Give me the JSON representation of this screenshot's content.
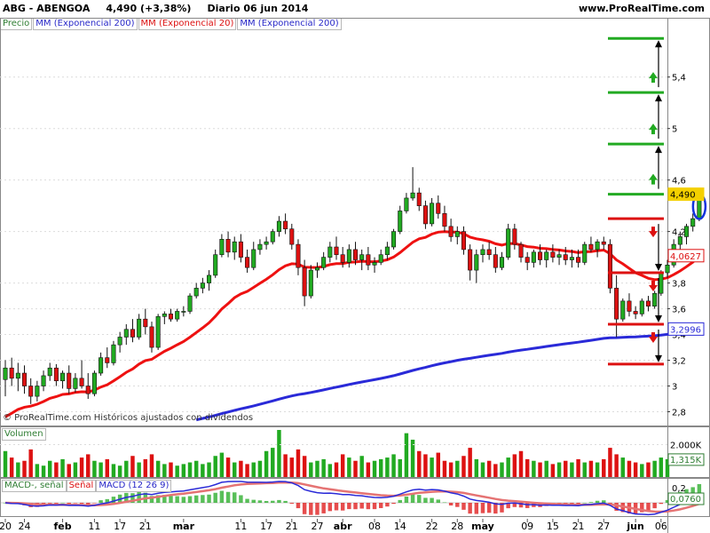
{
  "header": {
    "ticker": "ABG - ABENGOA",
    "price_change": "4,490 (+3,38%)",
    "period_date": "Diario  06 jun 2014",
    "site": "www.ProRealTime.com"
  },
  "indicators": {
    "precio": "Precio",
    "ema200_a": "MM (Exponencial 200)",
    "ema20": "MM (Exponencial 20)",
    "ema200_b": "MM (Exponencial 200)"
  },
  "volume_panel": {
    "label": "Volumen"
  },
  "macd_panel": {
    "label_macd_signal": "MACD-, señal",
    "label_senal": "Señal",
    "label_macd": "MACD (12 26 9)"
  },
  "footnote": "© ProRealTime.com  Históricos ajustados con dividendos",
  "colors": {
    "up": "#21aa21",
    "down": "#dd1111",
    "ema20": "#ee1111",
    "ema200": "#2a2ad8",
    "grid": "#dcdcdc",
    "marker": "#1133dd"
  },
  "chart_data": [
    {
      "type": "candlestick",
      "title": "ABG - ABENGOA",
      "ylim": [
        2.7,
        5.75
      ],
      "y_ticks": [
        "5,4",
        "5",
        "4,6",
        "4,2",
        "3,8",
        "3,4",
        "3",
        "2,8",
        "3,6",
        "3,2"
      ],
      "y_tick_values": [
        5.4,
        5.0,
        4.6,
        4.2,
        3.8,
        3.4,
        3.0,
        2.8,
        3.6,
        3.2
      ],
      "x_labels": [
        "20",
        "24",
        "feb",
        "11",
        "17",
        "21",
        "mar",
        "11",
        "17",
        "21",
        "27",
        "abr",
        "08",
        "14",
        "22",
        "28",
        "may",
        "09",
        "15",
        "21",
        "27",
        "jun",
        "06"
      ],
      "x_label_days": [
        0,
        3,
        9,
        14,
        18,
        22,
        28,
        37,
        41,
        45,
        49,
        53,
        58,
        62,
        67,
        71,
        75,
        82,
        86,
        90,
        94,
        99,
        103
      ],
      "num_days": 104,
      "price_labels": {
        "last": "4,490",
        "ema20": "4,0627",
        "ema200": "3,2996"
      },
      "target_levels": [
        5.7,
        5.28,
        4.88,
        4.49
      ],
      "stop_levels": [
        4.3,
        3.88,
        3.48,
        3.17
      ],
      "candles": [
        [
          3.05,
          3.2,
          2.92,
          3.14
        ],
        [
          3.14,
          3.22,
          3.0,
          3.06
        ],
        [
          3.06,
          3.18,
          2.96,
          3.1
        ],
        [
          3.1,
          3.16,
          2.94,
          3.0
        ],
        [
          3.0,
          3.06,
          2.86,
          2.92
        ],
        [
          2.92,
          3.04,
          2.88,
          3.0
        ],
        [
          3.0,
          3.12,
          2.96,
          3.08
        ],
        [
          3.08,
          3.18,
          3.04,
          3.14
        ],
        [
          3.14,
          3.17,
          3.0,
          3.04
        ],
        [
          3.04,
          3.12,
          2.98,
          3.1
        ],
        [
          3.1,
          3.16,
          2.94,
          2.98
        ],
        [
          2.98,
          3.1,
          2.95,
          3.06
        ],
        [
          3.06,
          3.2,
          2.98,
          3.0
        ],
        [
          3.0,
          3.1,
          2.9,
          2.94
        ],
        [
          2.94,
          3.12,
          2.92,
          3.1
        ],
        [
          3.1,
          3.26,
          3.08,
          3.22
        ],
        [
          3.22,
          3.3,
          3.14,
          3.18
        ],
        [
          3.18,
          3.35,
          3.16,
          3.32
        ],
        [
          3.32,
          3.42,
          3.26,
          3.38
        ],
        [
          3.38,
          3.48,
          3.32,
          3.44
        ],
        [
          3.44,
          3.52,
          3.34,
          3.38
        ],
        [
          3.38,
          3.56,
          3.36,
          3.52
        ],
        [
          3.52,
          3.6,
          3.4,
          3.46
        ],
        [
          3.46,
          3.5,
          3.26,
          3.3
        ],
        [
          3.3,
          3.56,
          3.28,
          3.54
        ],
        [
          3.54,
          3.58,
          3.48,
          3.56
        ],
        [
          3.56,
          3.6,
          3.5,
          3.52
        ],
        [
          3.52,
          3.6,
          3.5,
          3.58
        ],
        [
          3.58,
          3.62,
          3.54,
          3.58
        ],
        [
          3.58,
          3.72,
          3.56,
          3.7
        ],
        [
          3.7,
          3.8,
          3.68,
          3.76
        ],
        [
          3.76,
          3.84,
          3.72,
          3.8
        ],
        [
          3.8,
          3.9,
          3.74,
          3.86
        ],
        [
          3.86,
          4.06,
          3.84,
          4.02
        ],
        [
          4.02,
          4.18,
          4.0,
          4.14
        ],
        [
          4.14,
          4.2,
          4.0,
          4.04
        ],
        [
          4.04,
          4.16,
          3.98,
          4.12
        ],
        [
          4.12,
          4.18,
          3.96,
          4.0
        ],
        [
          4.0,
          4.06,
          3.88,
          3.92
        ],
        [
          3.92,
          4.12,
          3.9,
          4.06
        ],
        [
          4.06,
          4.14,
          4.02,
          4.1
        ],
        [
          4.1,
          4.16,
          4.06,
          4.12
        ],
        [
          4.12,
          4.22,
          4.1,
          4.2
        ],
        [
          4.2,
          4.32,
          4.16,
          4.28
        ],
        [
          4.28,
          4.34,
          4.18,
          4.22
        ],
        [
          4.22,
          4.26,
          4.06,
          4.1
        ],
        [
          4.1,
          4.14,
          3.86,
          3.92
        ],
        [
          3.92,
          3.98,
          3.62,
          3.7
        ],
        [
          3.7,
          3.94,
          3.68,
          3.9
        ],
        [
          3.9,
          3.96,
          3.84,
          3.92
        ],
        [
          3.92,
          4.04,
          3.9,
          4.0
        ],
        [
          4.0,
          4.12,
          3.96,
          4.08
        ],
        [
          4.08,
          4.16,
          3.98,
          4.02
        ],
        [
          4.02,
          4.08,
          3.92,
          3.96
        ],
        [
          3.96,
          4.1,
          3.92,
          4.06
        ],
        [
          4.06,
          4.12,
          3.94,
          3.98
        ],
        [
          3.98,
          4.06,
          3.9,
          4.02
        ],
        [
          4.02,
          4.08,
          3.9,
          3.94
        ],
        [
          3.94,
          4.0,
          3.88,
          3.96
        ],
        [
          3.96,
          4.06,
          3.94,
          4.02
        ],
        [
          4.02,
          4.12,
          3.98,
          4.08
        ],
        [
          4.08,
          4.22,
          4.06,
          4.2
        ],
        [
          4.2,
          4.4,
          4.18,
          4.36
        ],
        [
          4.36,
          4.5,
          4.34,
          4.46
        ],
        [
          4.46,
          4.7,
          4.44,
          4.5
        ],
        [
          4.5,
          4.54,
          4.36,
          4.4
        ],
        [
          4.4,
          4.44,
          4.22,
          4.26
        ],
        [
          4.26,
          4.46,
          4.24,
          4.42
        ],
        [
          4.42,
          4.48,
          4.3,
          4.34
        ],
        [
          4.34,
          4.4,
          4.2,
          4.24
        ],
        [
          4.24,
          4.3,
          4.12,
          4.16
        ],
        [
          4.16,
          4.24,
          4.1,
          4.2
        ],
        [
          4.2,
          4.24,
          4.02,
          4.06
        ],
        [
          4.06,
          4.1,
          3.82,
          3.9
        ],
        [
          3.9,
          4.06,
          3.8,
          4.02
        ],
        [
          4.02,
          4.1,
          3.96,
          4.06
        ],
        [
          4.06,
          4.12,
          3.98,
          4.02
        ],
        [
          4.02,
          4.08,
          3.88,
          3.92
        ],
        [
          3.92,
          4.04,
          3.9,
          4.0
        ],
        [
          4.0,
          4.26,
          3.98,
          4.22
        ],
        [
          4.22,
          4.26,
          4.06,
          4.1
        ],
        [
          4.1,
          4.12,
          3.96,
          4.0
        ],
        [
          4.0,
          4.04,
          3.9,
          3.96
        ],
        [
          3.96,
          4.06,
          3.92,
          4.04
        ],
        [
          4.04,
          4.1,
          3.94,
          3.98
        ],
        [
          3.98,
          4.06,
          3.92,
          4.04
        ],
        [
          4.04,
          4.1,
          3.96,
          4.0
        ],
        [
          4.0,
          4.06,
          3.94,
          4.02
        ],
        [
          4.02,
          4.08,
          3.94,
          3.98
        ],
        [
          3.98,
          4.06,
          3.92,
          4.0
        ],
        [
          4.0,
          4.06,
          3.92,
          3.96
        ],
        [
          3.96,
          4.12,
          3.94,
          4.1
        ],
        [
          4.1,
          4.16,
          4.04,
          4.06
        ],
        [
          4.06,
          4.14,
          4.0,
          4.12
        ],
        [
          4.12,
          4.16,
          4.06,
          4.1
        ],
        [
          4.1,
          4.14,
          3.72,
          3.76
        ],
        [
          3.76,
          3.86,
          3.38,
          3.52
        ],
        [
          3.52,
          3.68,
          3.5,
          3.66
        ],
        [
          3.66,
          3.72,
          3.54,
          3.58
        ],
        [
          3.58,
          3.62,
          3.52,
          3.56
        ],
        [
          3.56,
          3.68,
          3.54,
          3.66
        ],
        [
          3.66,
          3.7,
          3.58,
          3.62
        ],
        [
          3.62,
          3.74,
          3.6,
          3.72
        ],
        [
          3.72,
          3.9,
          3.7,
          3.88
        ],
        [
          3.88,
          3.98,
          3.84,
          3.94
        ],
        [
          3.94,
          4.14,
          3.92,
          4.1
        ],
        [
          4.1,
          4.2,
          4.04,
          4.16
        ],
        [
          4.16,
          4.26,
          4.1,
          4.24
        ],
        [
          4.24,
          4.34,
          4.2,
          4.3
        ],
        [
          4.3,
          4.51,
          4.28,
          4.49
        ]
      ]
    },
    {
      "type": "bar",
      "title": "Volumen",
      "y_ticks": [
        "2.000K"
      ],
      "last_value_label": "1,315K",
      "values": [
        1.6,
        1.2,
        0.9,
        1.0,
        1.7,
        0.8,
        0.7,
        1.0,
        0.9,
        1.1,
        0.8,
        0.9,
        1.2,
        1.4,
        1.0,
        0.9,
        1.1,
        0.8,
        0.7,
        1.0,
        1.3,
        0.9,
        1.1,
        1.4,
        1.0,
        0.8,
        0.9,
        0.7,
        0.8,
        0.9,
        1.0,
        0.8,
        0.9,
        1.3,
        1.5,
        1.2,
        0.9,
        1.0,
        0.8,
        0.9,
        1.0,
        1.6,
        1.8,
        2.9,
        1.4,
        1.2,
        1.7,
        1.3,
        0.9,
        1.0,
        1.1,
        0.8,
        0.9,
        1.4,
        1.2,
        1.0,
        1.3,
        0.9,
        1.0,
        1.1,
        1.2,
        1.4,
        1.1,
        2.7,
        2.3,
        1.6,
        1.4,
        1.2,
        1.5,
        1.0,
        0.9,
        1.0,
        1.3,
        1.8,
        1.1,
        0.9,
        1.0,
        0.8,
        0.9,
        1.2,
        1.4,
        1.6,
        1.1,
        1.0,
        0.9,
        1.0,
        0.8,
        0.9,
        1.0,
        0.9,
        1.1,
        0.9,
        1.0,
        0.9,
        1.1,
        1.8,
        1.4,
        1.2,
        1.0,
        0.9,
        0.8,
        0.9,
        1.0,
        1.2,
        1.1
      ]
    },
    {
      "type": "line",
      "title": "MACD (12 26 9)",
      "y_ticks": [
        "0,2"
      ],
      "last_value_label": "0,0760"
    }
  ]
}
